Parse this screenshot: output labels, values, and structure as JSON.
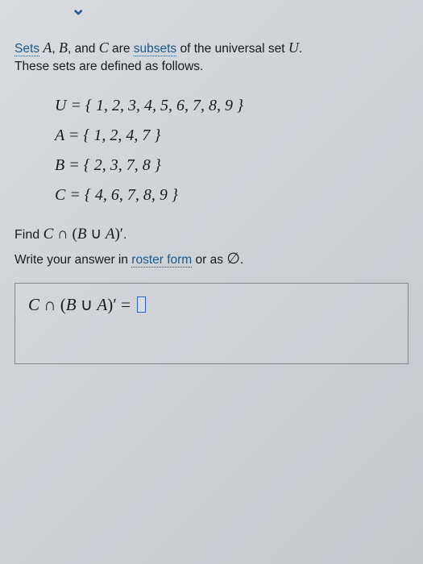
{
  "chevron": "⌄",
  "intro": {
    "sets_link": "Sets",
    "var_a": "A",
    "sep1": ", ",
    "var_b": "B",
    "sep2": ", and ",
    "var_c": "C",
    "mid": " are ",
    "subsets_link": "subsets",
    "mid2": " of the universal set ",
    "var_u": "U",
    "period": ".",
    "line2": "These sets are defined as follows."
  },
  "sets": {
    "u": "U = { 1, 2, 3, 4, 5, 6, 7, 8, 9 }",
    "a": "A = { 1, 2, 4, 7 }",
    "b": "B = { 2, 3, 7, 8 }",
    "c": "C = { 4, 6, 7, 8, 9 }"
  },
  "find": {
    "prefix": "Find ",
    "expr_c": "C",
    "cap": " ∩ ",
    "open": "(",
    "expr_b": "B",
    "cup": " ∪ ",
    "expr_a": "A",
    "close": ")′",
    "suffix": "."
  },
  "write": {
    "prefix": "Write your answer in ",
    "roster_link": "roster form",
    "mid": " or as ",
    "empty": "∅",
    "suffix": "."
  },
  "answer": {
    "expr_c": "C",
    "cap": " ∩ ",
    "open": "(",
    "expr_b": "B",
    "cup": " ∪ ",
    "expr_a": "A",
    "close": ")′",
    "eq": " = "
  }
}
